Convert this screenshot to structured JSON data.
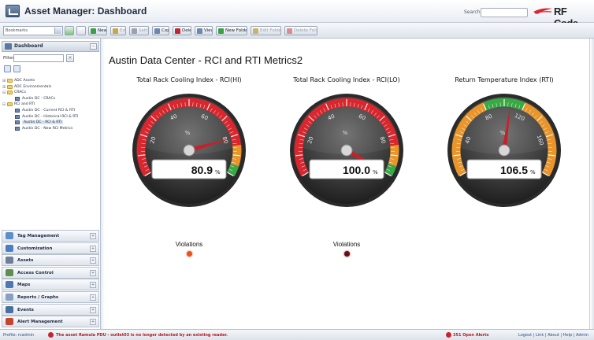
{
  "header": {
    "title": "Asset Manager: Dashboard",
    "search_label": "Search",
    "logo_text": "RF Code"
  },
  "toolbar": {
    "bookmarks_select": "Bookmarks",
    "buttons": [
      {
        "label": "New",
        "disabled": false,
        "icon": "green-plus-icon",
        "color": "#3ca043"
      },
      {
        "label": "Edit",
        "disabled": true,
        "icon": "pencil-icon",
        "color": "#c9a64a"
      },
      {
        "label": "Settings",
        "disabled": true,
        "icon": "gear-icon",
        "color": "#9aa2ad"
      },
      {
        "label": "Copy",
        "disabled": false,
        "icon": "copy-icon",
        "color": "#6d87b0"
      },
      {
        "label": "Delete",
        "disabled": false,
        "icon": "red-x-icon",
        "color": "#c7252d"
      },
      {
        "label": "View",
        "disabled": false,
        "icon": "magnifier-icon",
        "color": "#6d87b0"
      },
      {
        "label": "New Folder",
        "disabled": false,
        "icon": "green-plus-icon",
        "color": "#3ca043"
      },
      {
        "label": "Edit Folder",
        "disabled": true,
        "icon": "folder-icon",
        "color": "#c9b26a"
      },
      {
        "label": "Delete Folder",
        "disabled": true,
        "icon": "red-x-icon",
        "color": "#d98d90"
      }
    ]
  },
  "sidebar": {
    "dashboard_title": "Dashboard",
    "filter_label": "Filter",
    "tree": [
      {
        "label": "ADC Assets",
        "level": 0,
        "kind": "folder",
        "toggle": "+"
      },
      {
        "label": "ADC Environmentals",
        "level": 0,
        "kind": "folder",
        "toggle": "+"
      },
      {
        "label": "CRACs",
        "level": 0,
        "kind": "folder",
        "toggle": "-"
      },
      {
        "label": "Austin DC - CRACs",
        "level": 1,
        "kind": "dashboard",
        "toggle": ""
      },
      {
        "label": "RCI and RTI",
        "level": 0,
        "kind": "folder",
        "toggle": "-"
      },
      {
        "label": "Austin DC - Current RCI & RTI",
        "level": 1,
        "kind": "dashboard",
        "toggle": ""
      },
      {
        "label": "Austin DC - Historical RCI & RTI",
        "level": 1,
        "kind": "dashboard",
        "toggle": ""
      },
      {
        "label": "Austin DC - RCI & RTI",
        "level": 1,
        "kind": "dashboard",
        "toggle": "",
        "selected": true
      },
      {
        "label": "Austin DC - New RCI Metrics",
        "level": 1,
        "kind": "dashboard",
        "toggle": ""
      }
    ],
    "nav": [
      {
        "label": "Tag Management",
        "icon": "tag-management-icon",
        "color": "#5b8fc7"
      },
      {
        "label": "Customization",
        "icon": "customization-icon",
        "color": "#4a7fc0"
      },
      {
        "label": "Assets",
        "icon": "assets-icon",
        "color": "#6f7f9a"
      },
      {
        "label": "Access Control",
        "icon": "access-control-icon",
        "color": "#5f8f4f"
      },
      {
        "label": "Maps",
        "icon": "maps-icon",
        "color": "#4f78b0"
      },
      {
        "label": "Reports / Graphs",
        "icon": "reports-graphs-icon",
        "color": "#8aa0c0"
      },
      {
        "label": "Events",
        "icon": "events-icon",
        "color": "#4c6f9f"
      },
      {
        "label": "Alert Management",
        "icon": "alert-management-icon",
        "color": "#c7452d"
      }
    ]
  },
  "main": {
    "title": "Austin Data Center - RCI and RTI Metrics2",
    "gauges": [
      {
        "title": "Total Rack Cooling Index - RCI(HI)",
        "value": "80.9",
        "needle_value": 80.9,
        "unit": "%",
        "min": 0,
        "max": 100,
        "ticks": [
          "0",
          "20",
          "40",
          "60",
          "80",
          "100"
        ],
        "bands": [
          {
            "from": 0,
            "to": 85,
            "color": "#d8272e"
          },
          {
            "from": 85,
            "to": 95,
            "color": "#e8952b"
          },
          {
            "from": 95,
            "to": 100,
            "color": "#3aa845"
          }
        ],
        "violations_label": "Violations",
        "violation_color": "#e8541d"
      },
      {
        "title": "Total Rack Cooling Index - RCI(LO)",
        "value": "100.0",
        "needle_value": 100.0,
        "unit": "%",
        "min": 0,
        "max": 100,
        "ticks": [
          "0",
          "20",
          "40",
          "60",
          "80",
          "100"
        ],
        "bands": [
          {
            "from": 0,
            "to": 85,
            "color": "#d8272e"
          },
          {
            "from": 85,
            "to": 95,
            "color": "#e8952b"
          },
          {
            "from": 95,
            "to": 100,
            "color": "#3aa845"
          }
        ],
        "violations_label": "Violations",
        "violation_color": "#6a0f10"
      },
      {
        "title": "Return Temperature Index (RTI)",
        "value": "106.5",
        "needle_value": 106.5,
        "unit": "%",
        "min": 0,
        "max": 200,
        "ticks": [
          "0",
          "40",
          "80",
          "120",
          "160",
          "200"
        ],
        "bands": [
          {
            "from": 0,
            "to": 80,
            "color": "#e8952b"
          },
          {
            "from": 80,
            "to": 120,
            "color": "#3aa845"
          },
          {
            "from": 120,
            "to": 200,
            "color": "#e8952b"
          }
        ]
      }
    ]
  },
  "statusbar": {
    "profile": "Profile: rcadmin",
    "alert": "The asset Ramula PDU - outlet03 is no longer detected by an existing reader.",
    "open_alerts": "351 Open Alerts",
    "links": "Logout | Link | About | Help | Admin"
  },
  "colors": {
    "brand_red": "#d8272e",
    "needle": "#c8202a",
    "gauge_body": "#3b3b3b"
  }
}
